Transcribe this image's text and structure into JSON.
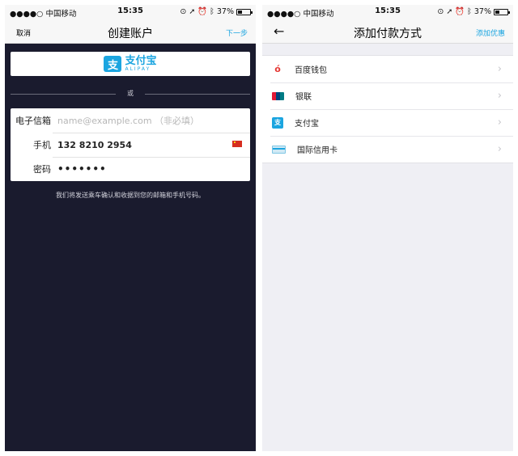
{
  "status_bar": {
    "carrier": "●●●●○ 中国移动",
    "time": "15:35",
    "icons": [
      "location-icon",
      "lock-icon",
      "alarm-icon",
      "bluetooth-icon"
    ],
    "battery_label": "37%",
    "battery_level": 0.37
  },
  "create_account": {
    "nav": {
      "cancel": "取消",
      "title": "创建账户",
      "next": "下一步"
    },
    "alipay_button": {
      "logo_glyph": "支",
      "name_cn": "支付宝",
      "name_en": "ALIPAY"
    },
    "divider_text": "或",
    "form": {
      "email_label": "电子信箱",
      "email_placeholder": "name@example.com （非必填）",
      "phone_label": "手机",
      "phone_value": "132 8210 2954",
      "password_label": "密码",
      "password_value": "•••••••"
    },
    "notice": "我们将发送乘车确认和收据到您的邮箱和手机号码。"
  },
  "add_payment": {
    "nav": {
      "back_glyph": "←",
      "title": "添加付款方式",
      "promo": "添加优惠"
    },
    "methods": [
      {
        "label": "百度钱包",
        "icon": "baidu-wallet-icon"
      },
      {
        "label": "银联",
        "icon": "unionpay-icon"
      },
      {
        "label": "支付宝",
        "icon": "alipay-icon"
      },
      {
        "label": "国际信用卡",
        "icon": "credit-card-icon"
      }
    ],
    "chevron_glyph": "›"
  },
  "colors": {
    "accent": "#1ba5e0",
    "dark_background": "#1a1b2e",
    "list_background": "#efeff4"
  }
}
